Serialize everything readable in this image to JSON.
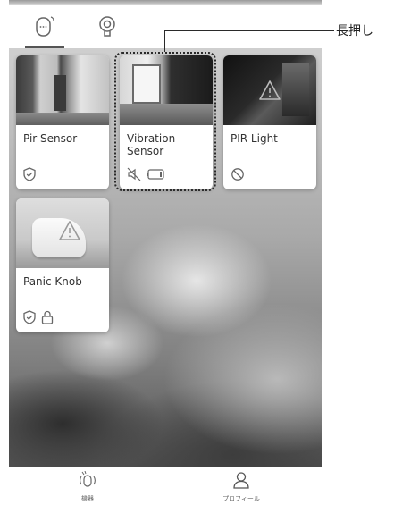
{
  "callout": {
    "label": "長押し"
  },
  "top_tabs": [
    {
      "icon": "sensor-device-icon",
      "selected": true
    },
    {
      "icon": "camera-device-icon",
      "selected": false
    }
  ],
  "devices": [
    {
      "name": "Pir Sensor",
      "status_icons": [
        "shield-check-icon"
      ]
    },
    {
      "name": "Vibration Sensor",
      "status_icons": [
        "mute-icon",
        "battery-icon"
      ]
    },
    {
      "name": "PIR Light",
      "status_icons": [
        "prohibited-icon"
      ],
      "image_overlay": "warning-icon"
    },
    {
      "name": "Panic Knob",
      "status_icons": [
        "shield-check-icon",
        "lock-icon"
      ],
      "image_overlay": "warning-icon"
    }
  ],
  "bottom_nav": {
    "devices_label": "機器",
    "profile_label": "プロフィール"
  },
  "colors": {
    "icon": "#666666",
    "card": "#ffffff",
    "callout_line": "#2a2a2a"
  }
}
